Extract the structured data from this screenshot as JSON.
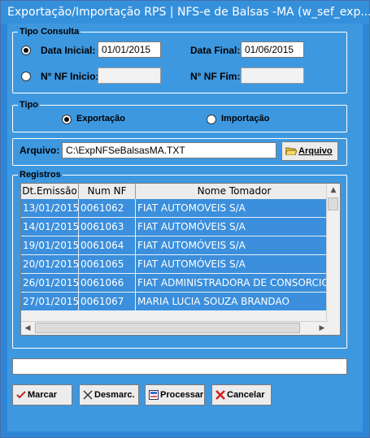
{
  "window": {
    "title": "Exportação/Importação RPS  |  NFS-e de Balsas -MA (w_sef_exp..."
  },
  "tipo_consulta": {
    "group_title": "Tipo Consulta",
    "data_inicial_label": "Data Inicial:",
    "data_inicial_value": "01/01/2015",
    "data_final_label": "Data Final:",
    "data_final_value": "01/06/2015",
    "nf_inicio_label": "N° NF Inicio:",
    "nf_inicio_value": "",
    "nf_fim_label": "N° NF Fim:",
    "nf_fim_value": "",
    "selected": "data"
  },
  "tipo": {
    "group_title": "Tipo",
    "exportacao_label": "Exportação",
    "importacao_label": "Importação",
    "selected": "exportacao"
  },
  "arquivo": {
    "label": "Arquivo:",
    "value": "C:\\ExpNFSeBalsasMA.TXT",
    "button_label": "Arquivo"
  },
  "registros": {
    "group_title": "Registros",
    "columns": [
      "Dt.Emissão",
      "Num NF",
      "Nome Tomador"
    ],
    "rows": [
      [
        "13/01/2015",
        "0061062",
        "FIAT AUTOMOVEIS S/A"
      ],
      [
        "14/01/2015",
        "0061063",
        "FIAT AUTOMÓVEIS S/A"
      ],
      [
        "19/01/2015",
        "0061064",
        "FIAT AUTOMÓVEIS S/A"
      ],
      [
        "20/01/2015",
        "0061065",
        "FIAT AUTOMÓVEIS S/A"
      ],
      [
        "26/01/2015",
        "0061066",
        "FIAT ADMINISTRADORA DE CONSORCIO"
      ],
      [
        "27/01/2015",
        "0061067",
        "MARIA LUCIA SOUZA BRANDAO"
      ]
    ]
  },
  "status": {
    "text": ""
  },
  "buttons": {
    "marcar": "Marcar",
    "desmarcar": "Desmarc.",
    "processar": "Processar",
    "cancelar": "Cancelar"
  },
  "colors": {
    "titlebar": "#3590dc",
    "client": "#3e98e0",
    "row_selected": "#3b8fdc"
  }
}
